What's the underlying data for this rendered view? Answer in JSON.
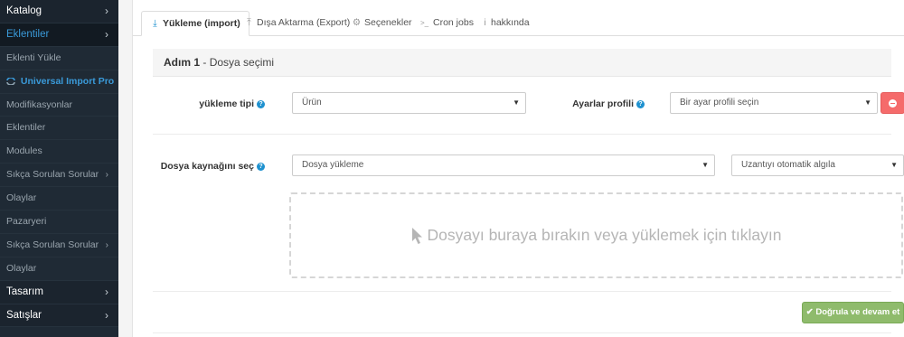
{
  "sidebar": {
    "items": [
      {
        "label": "Katalog",
        "chevron": "›"
      },
      {
        "label": "Eklentiler",
        "chevron": "›"
      },
      {
        "label": "Eklenti Yükle"
      },
      {
        "label": "Universal Import Pro",
        "icon": "universal-import-icon"
      },
      {
        "label": "Modifikasyonlar"
      },
      {
        "label": "Eklentiler"
      },
      {
        "label": "Modules"
      },
      {
        "label": "Sıkça Sorulan Sorular",
        "chevron": "›"
      },
      {
        "label": "Olaylar"
      },
      {
        "label": "Pazaryeri"
      },
      {
        "label": "Sıkça Sorulan Sorular",
        "chevron": "›"
      },
      {
        "label": "Olaylar"
      },
      {
        "label": "Tasarım",
        "chevron": "›"
      },
      {
        "label": "Satışlar",
        "chevron": "›"
      }
    ]
  },
  "tabs": [
    {
      "label": "Yükleme (import)",
      "icon": "download-icon",
      "icon_glyph": "⤓"
    },
    {
      "label": "Dışa Aktarma (Export)",
      "icon": "upload-icon",
      "icon_glyph": "⤒"
    },
    {
      "label": "Seçenekler",
      "icon": "gear-icon",
      "icon_glyph": "⚙"
    },
    {
      "label": "Cron jobs",
      "icon": "terminal-icon",
      "icon_glyph": ">_"
    },
    {
      "label": "hakkında",
      "icon": "info-icon",
      "icon_glyph": "i"
    }
  ],
  "step": {
    "number": "Adım 1",
    "separator": " - ",
    "title": "Dosya seçimi"
  },
  "form": {
    "import_type_label": "yükleme tipi",
    "import_type_value": "Ürün",
    "profile_label": "Ayarlar profili",
    "profile_value": "Bir ayar profili seçin",
    "source_label": "Dosya kaynağını seç",
    "source_value": "Dosya yükleme",
    "extension_value": "Uzantıyı otomatik algıla",
    "help_glyph": "?",
    "caret_glyph": "▼"
  },
  "dropzone": {
    "text": "Dosyayı buraya bırakın veya yüklemek için tıklayın"
  },
  "buttons": {
    "validate_label": "Doğrula ve devam et",
    "check_glyph": "✔"
  },
  "colors": {
    "sidebar_bg": "#1f2a35",
    "accent": "#1e91cf",
    "link": "#3a9ad9",
    "danger": "#f56b6b",
    "success": "#8fbb6c"
  }
}
